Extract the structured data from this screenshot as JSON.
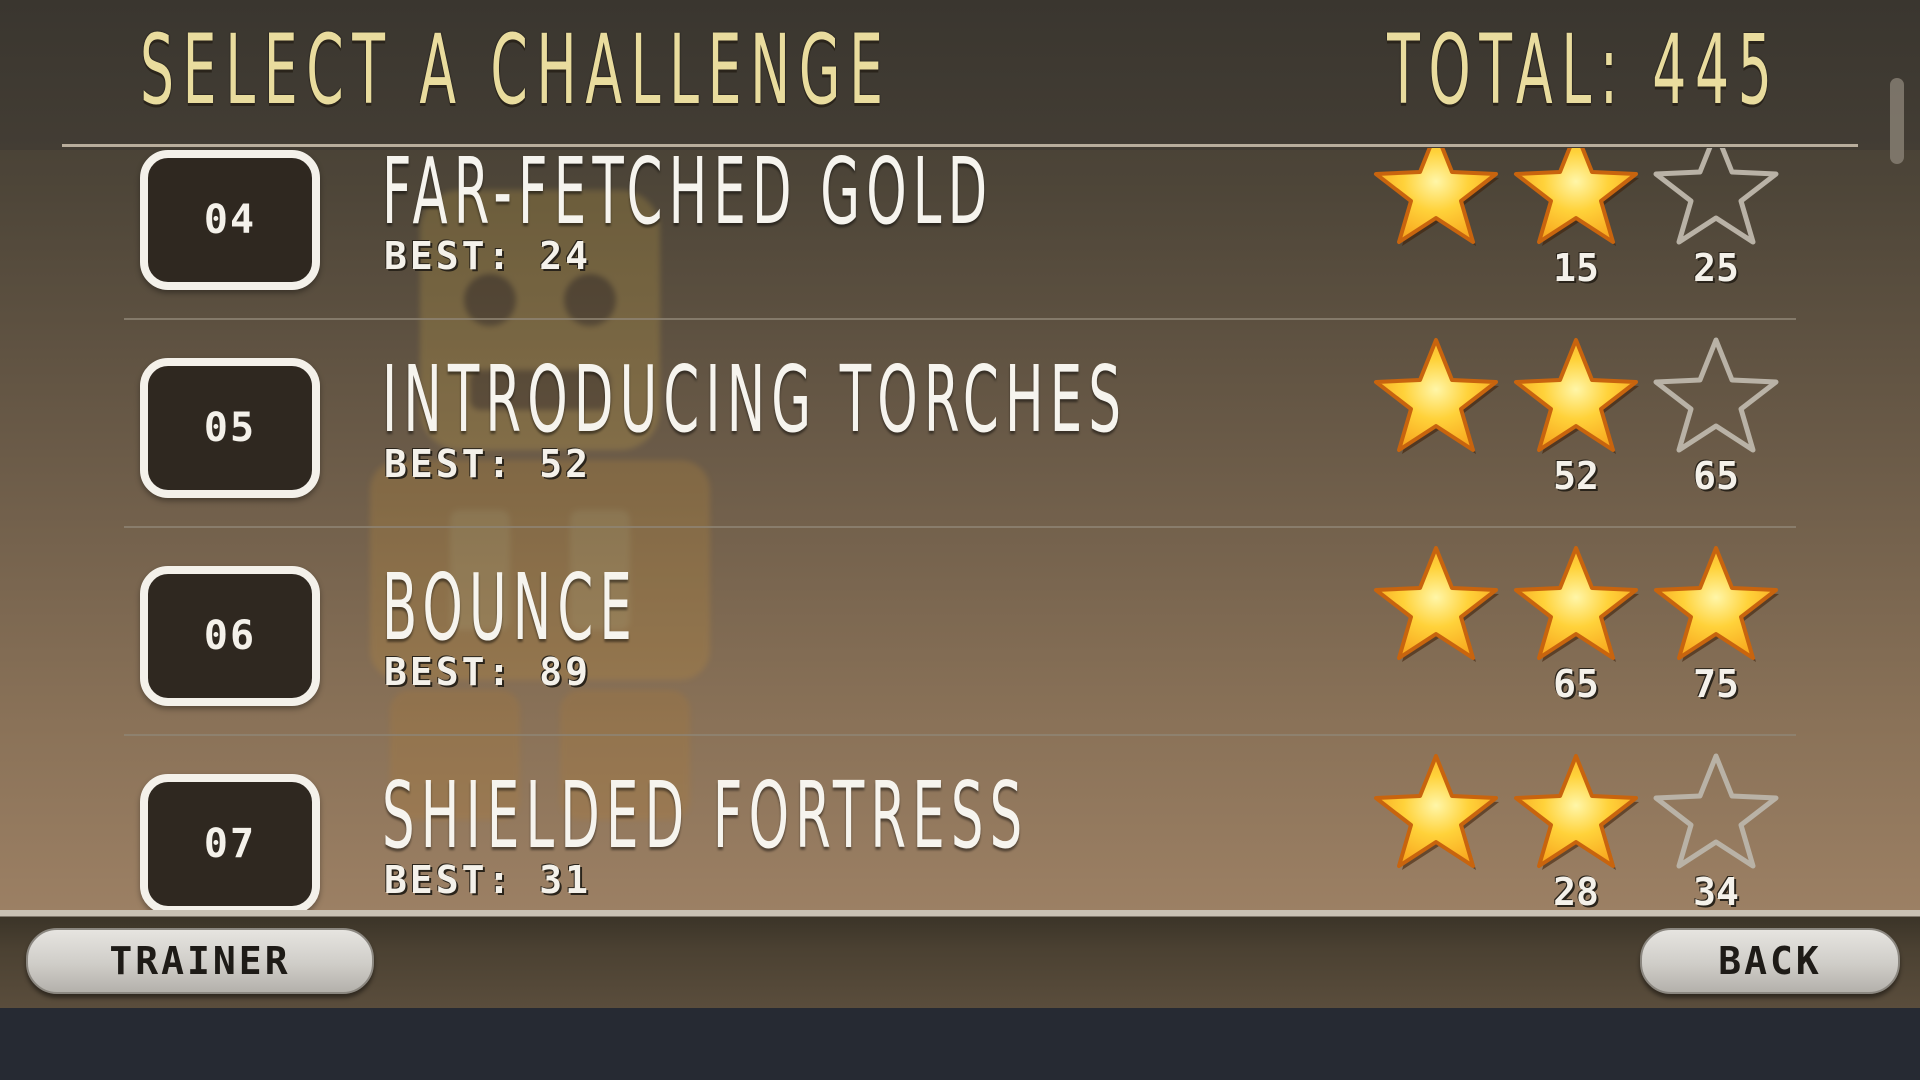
{
  "header": {
    "title": "SELECT A CHALLENGE",
    "total": "TOTAL: 445"
  },
  "challenges": [
    {
      "number": "04",
      "name": "FAR-FETCHED GOLD",
      "best": "BEST: 24",
      "stars_earned": 2,
      "thresholds": [
        "15",
        "25"
      ]
    },
    {
      "number": "05",
      "name": "INTRODUCING TORCHES",
      "best": "BEST: 52",
      "stars_earned": 2,
      "thresholds": [
        "52",
        "65"
      ]
    },
    {
      "number": "06",
      "name": "BOUNCE",
      "best": "BEST: 89",
      "stars_earned": 3,
      "thresholds": [
        "65",
        "75"
      ]
    },
    {
      "number": "07",
      "name": "SHIELDED FORTRESS",
      "best": "BEST: 31",
      "stars_earned": 2,
      "thresholds": [
        "28",
        "34"
      ]
    }
  ],
  "footer": {
    "trainer_label": "TRAINER",
    "back_label": "BACK"
  },
  "colors": {
    "title": "#e9dc9e",
    "star_fill": "#f7a21b",
    "star_empty": "#b9b2a6",
    "text": "#f4f1ea"
  },
  "icons": {
    "earned_star": "star-filled-icon",
    "empty_star": "star-outline-icon"
  }
}
